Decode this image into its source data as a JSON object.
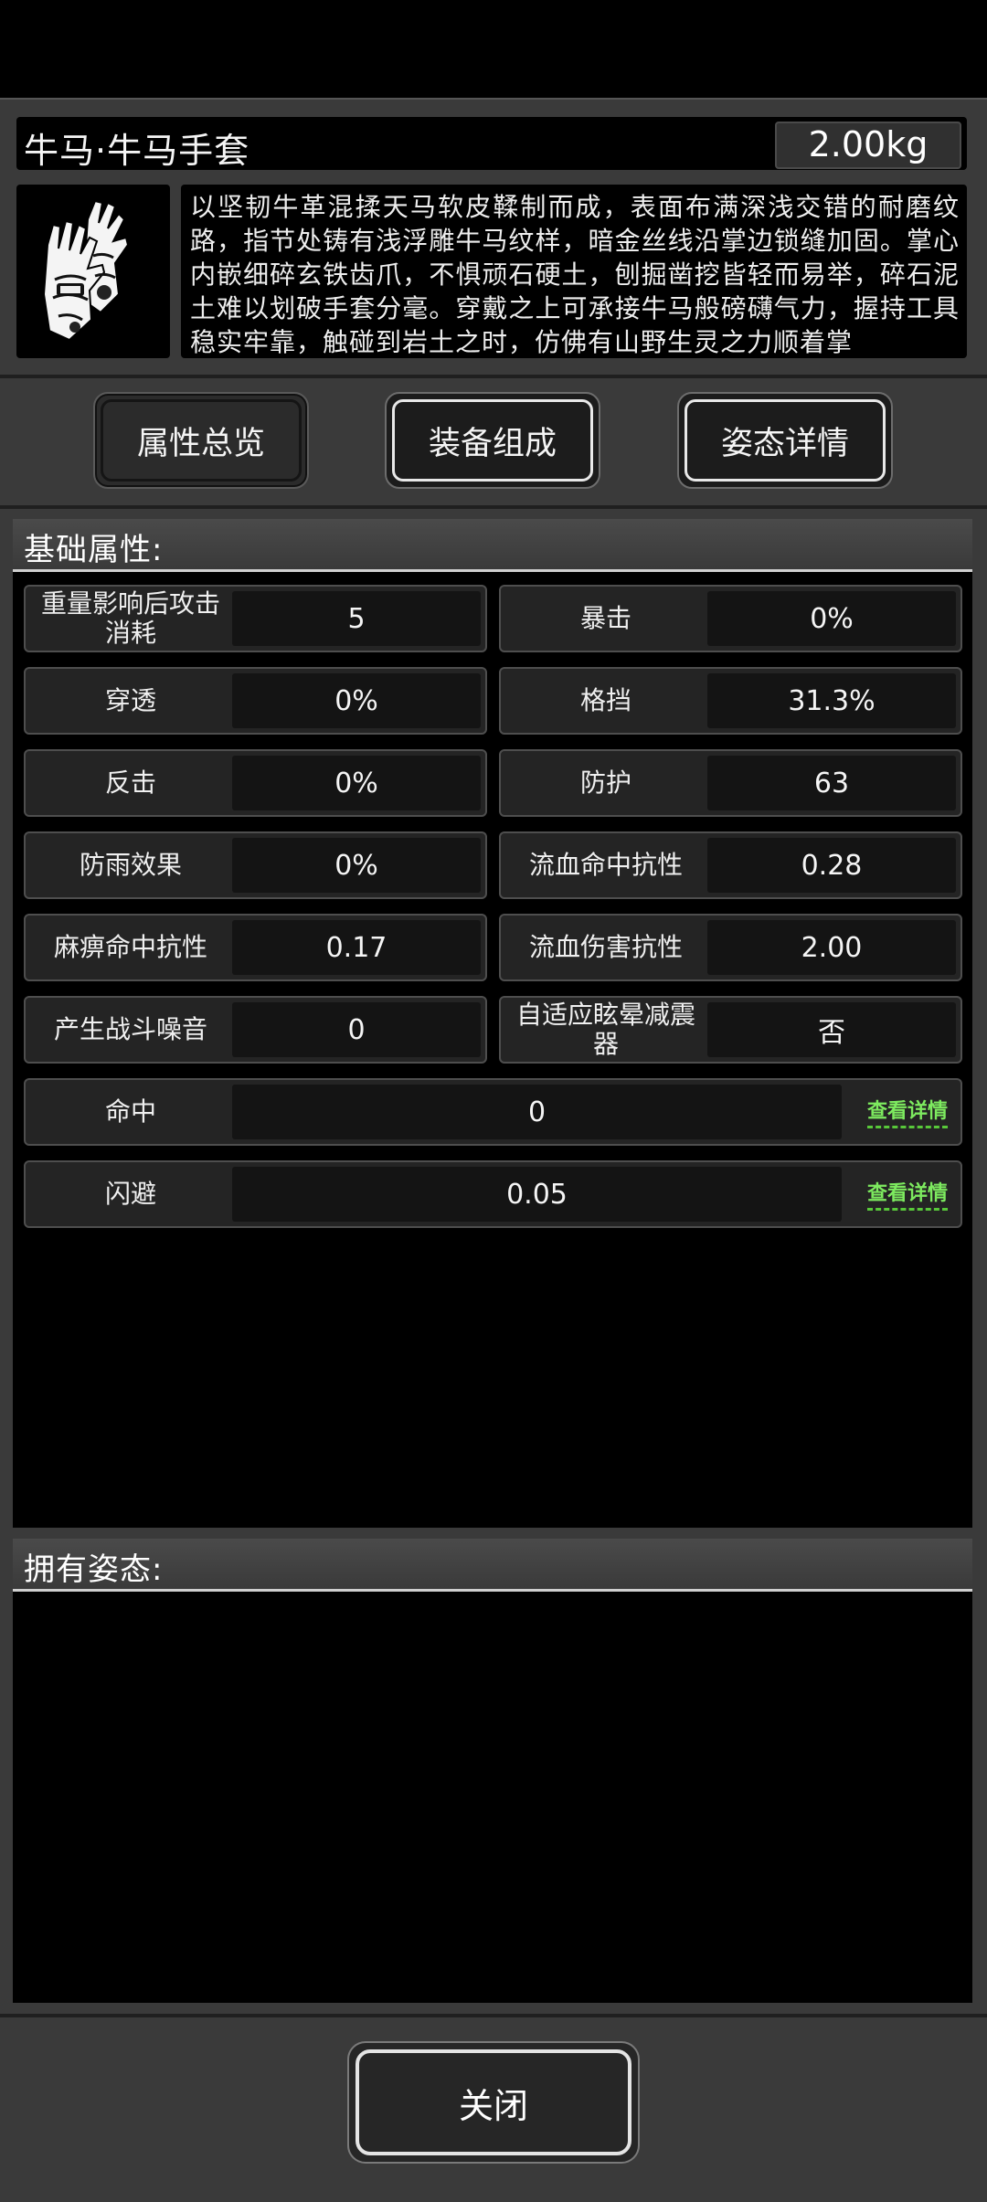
{
  "item": {
    "name": "牛马·牛马手套",
    "weight": "2.00kg",
    "description": "以坚韧牛革混揉天马软皮鞣制而成，表面布满深浅交错的耐磨纹路，指节处铸有浅浮雕牛马纹样，暗金丝线沿掌边锁缝加固。掌心内嵌细碎玄铁齿爪，不惧顽石硬土，刨掘凿挖皆轻而易举，碎石泥土难以划破手套分毫。穿戴之上可承接牛马般磅礴气力，握持工具稳实牢靠，触碰到岩土之时，仿佛有山野生灵之力顺着掌"
  },
  "tabs": [
    {
      "label": "属性总览",
      "active": true
    },
    {
      "label": "装备组成",
      "active": false
    },
    {
      "label": "姿态详情",
      "active": false
    }
  ],
  "basic": {
    "title": "基础属性:",
    "stats": [
      {
        "label": "重量影响后攻击消耗",
        "value": "5"
      },
      {
        "label": "暴击",
        "value": "0%"
      },
      {
        "label": "穿透",
        "value": "0%"
      },
      {
        "label": "格挡",
        "value": "31.3%"
      },
      {
        "label": "反击",
        "value": "0%"
      },
      {
        "label": "防护",
        "value": "63"
      },
      {
        "label": "防雨效果",
        "value": "0%"
      },
      {
        "label": "流血命中抗性",
        "value": "0.28"
      },
      {
        "label": "麻痹命中抗性",
        "value": "0.17"
      },
      {
        "label": "流血伤害抗性",
        "value": "2.00"
      },
      {
        "label": "产生战斗噪音",
        "value": "0"
      },
      {
        "label": "自适应眩晕减震器",
        "value": "否"
      }
    ],
    "wide_stats": [
      {
        "label": "命中",
        "value": "0",
        "link": "查看详情"
      },
      {
        "label": "闪避",
        "value": "0.05",
        "link": "查看详情"
      }
    ]
  },
  "stances": {
    "title": "拥有姿态:"
  },
  "close_label": "关闭",
  "colors": {
    "panel": "#3a3a3a",
    "link": "#7dea5f"
  }
}
